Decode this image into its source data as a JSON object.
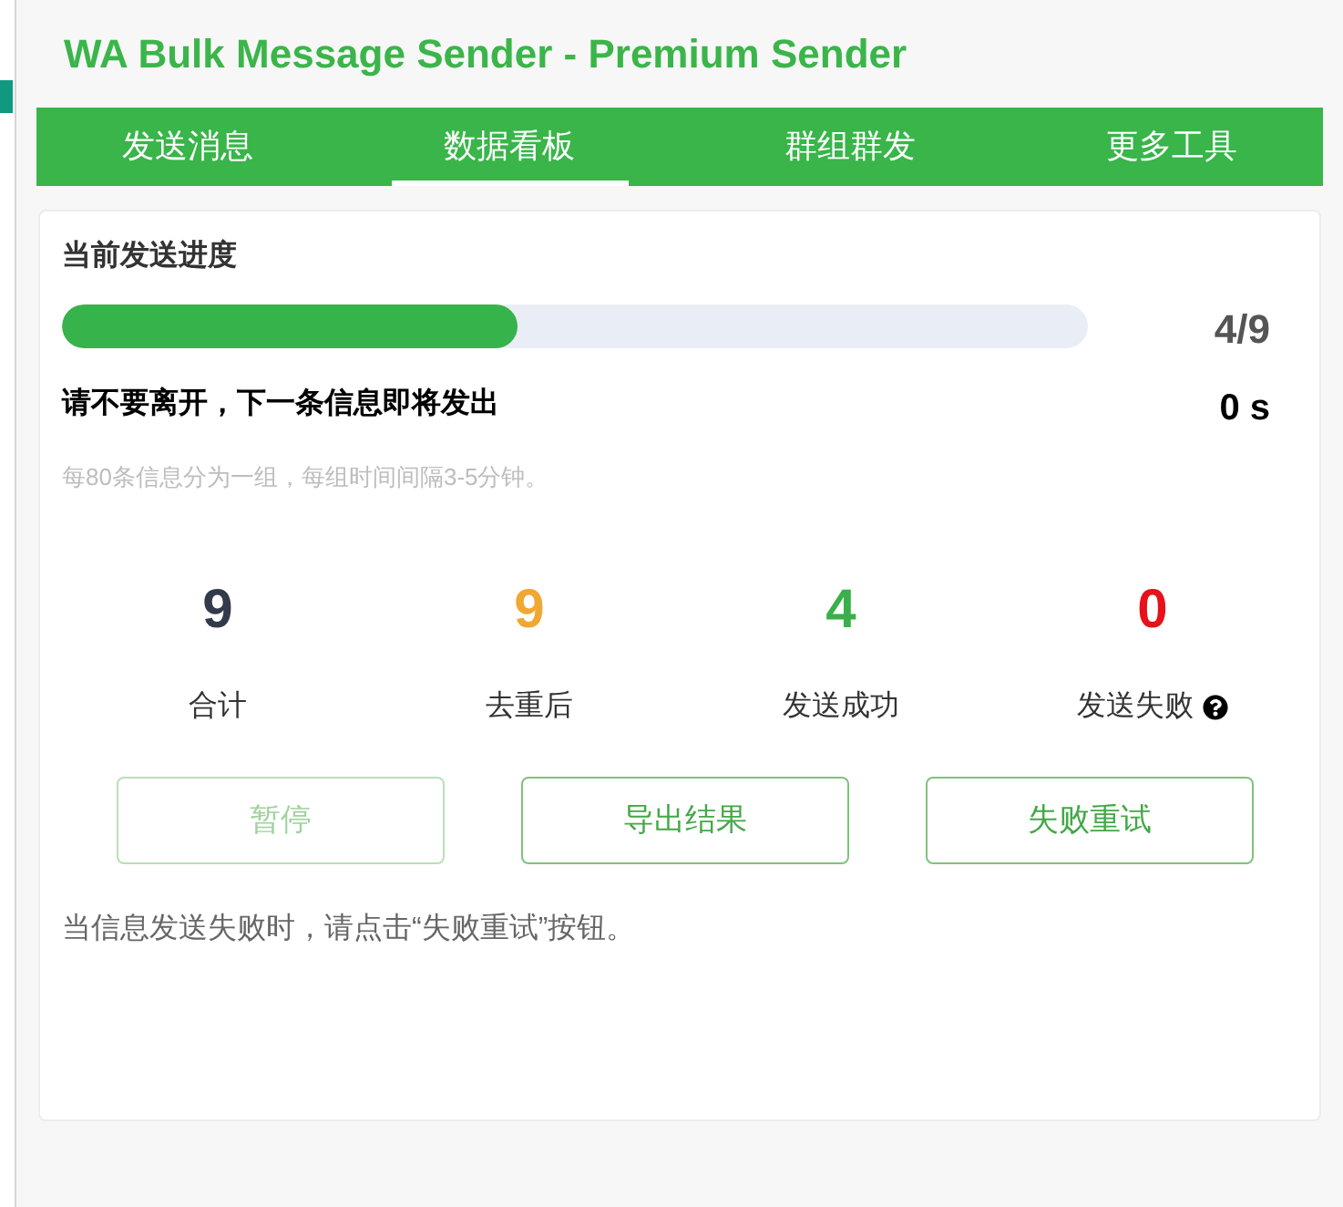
{
  "header": {
    "title": "WA Bulk Message Sender - Premium Sender"
  },
  "tabs": [
    {
      "label": "发送消息",
      "selected": false
    },
    {
      "label": "数据看板",
      "selected": true
    },
    {
      "label": "群组群发",
      "selected": false
    },
    {
      "label": "更多工具",
      "selected": false
    }
  ],
  "progress": {
    "heading": "当前发送进度",
    "level": 0.444,
    "count": "4/9",
    "status": "请不要离开，下一条信息即将发出",
    "countdown": "0 s",
    "hint": "每80条信息分为一组，每组时间间隔3-5分钟。"
  },
  "stats": [
    {
      "value": "9",
      "label": "合计",
      "color": "#323a4b",
      "kind": "plain"
    },
    {
      "value": "9",
      "label": "去重后",
      "color": "#f0a833",
      "kind": "plain"
    },
    {
      "value": "4",
      "label": "发送成功",
      "color": "#3bb04a",
      "kind": "plain"
    },
    {
      "value": "0",
      "label": "发送失败",
      "color": "#e8101a",
      "kind": "help"
    }
  ],
  "buttons": [
    {
      "label": "暂停",
      "disabled": true
    },
    {
      "label": "导出结果",
      "disabled": false
    },
    {
      "label": "失败重试",
      "disabled": false
    }
  ],
  "footer_note": "当信息发送失败时，请点击“失败重试”按钮。"
}
